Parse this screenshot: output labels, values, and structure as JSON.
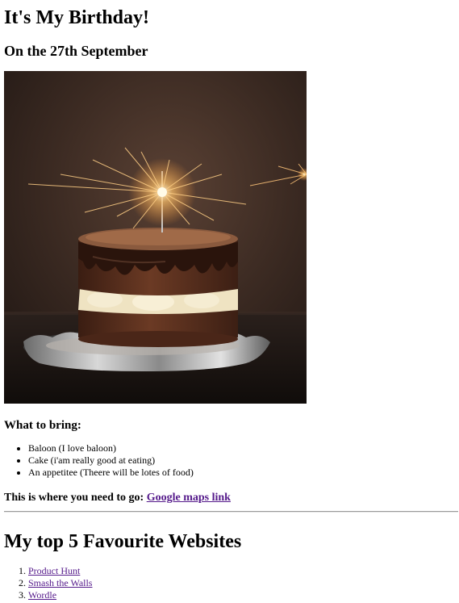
{
  "header": {
    "title": "It's My Birthday!",
    "subtitle": "On the 27th September"
  },
  "bring": {
    "heading": "What to bring:",
    "items": [
      "Baloon (I love baloon)",
      "Cake (i'am really good at eating)",
      "An appetitee (Theere will be lotes of food)"
    ]
  },
  "location": {
    "label": "This is where you need to go:",
    "link_text": "Google maps link"
  },
  "favourites": {
    "heading": "My top 5 Favourite Websites",
    "links": [
      "Product Hunt",
      "Smash the Walls",
      "Wordle"
    ]
  },
  "colors": {
    "visited_link": "#551a8b"
  }
}
